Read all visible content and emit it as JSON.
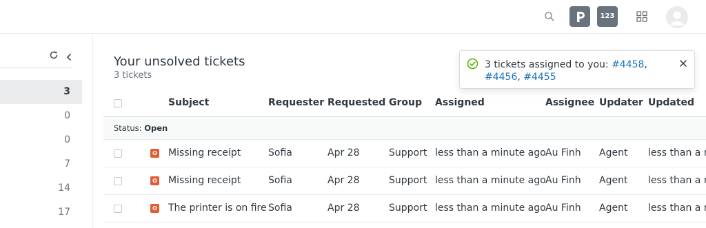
{
  "topbar": {
    "search_icon": "search-icon",
    "product_p_icon": "product-tray-p-icon",
    "app_badge_label": "123",
    "apps_icon": "grid-icon",
    "avatar_icon": "user-avatar-icon"
  },
  "sidebar": {
    "refresh_icon": "refresh-icon",
    "collapse_icon": "chevron-left-icon",
    "counts": [
      "3",
      "0",
      "0",
      "7",
      "14",
      "17"
    ]
  },
  "main": {
    "title": "Your unsolved tickets",
    "subtitle": "3 tickets"
  },
  "table": {
    "headers": {
      "subject": "Subject",
      "requester": "Requester",
      "requested": "Requested",
      "group": "Group",
      "assigned": "Assigned",
      "assignee": "Assignee",
      "updater": "Updater",
      "updated": "Updated"
    },
    "group_prefix": "Status:",
    "group_value": "Open",
    "rows": [
      {
        "status": "O",
        "subject": "Missing receipt",
        "requester": "Sofia",
        "requested": "Apr 28",
        "group": "Support",
        "assigned": "less than a minute ago",
        "assignee": "Au Finh",
        "updater": "Agent",
        "updated": "less than a m"
      },
      {
        "status": "O",
        "subject": "Missing receipt",
        "requester": "Sofia",
        "requested": "Apr 28",
        "group": "Support",
        "assigned": "less than a minute ago",
        "assignee": "Au Finh",
        "updater": "Agent",
        "updated": "less than a m"
      },
      {
        "status": "O",
        "subject": "The printer is on fire",
        "requester": "Sofia",
        "requested": "Apr 28",
        "group": "Support",
        "assigned": "less than a minute ago",
        "assignee": "Au Finh",
        "updater": "Agent",
        "updated": "less than a m"
      }
    ]
  },
  "toast": {
    "message": "3 tickets assigned to you:",
    "link1": "#4458",
    "sep1": ",",
    "link2": "#4456",
    "sep2": ",",
    "link3": "#4455",
    "check_icon": "check-circle-icon",
    "close_icon": "close-icon"
  },
  "colors": {
    "accent_link": "#1f73b7",
    "status_open": "#e35b30",
    "success": "#5eae00"
  }
}
